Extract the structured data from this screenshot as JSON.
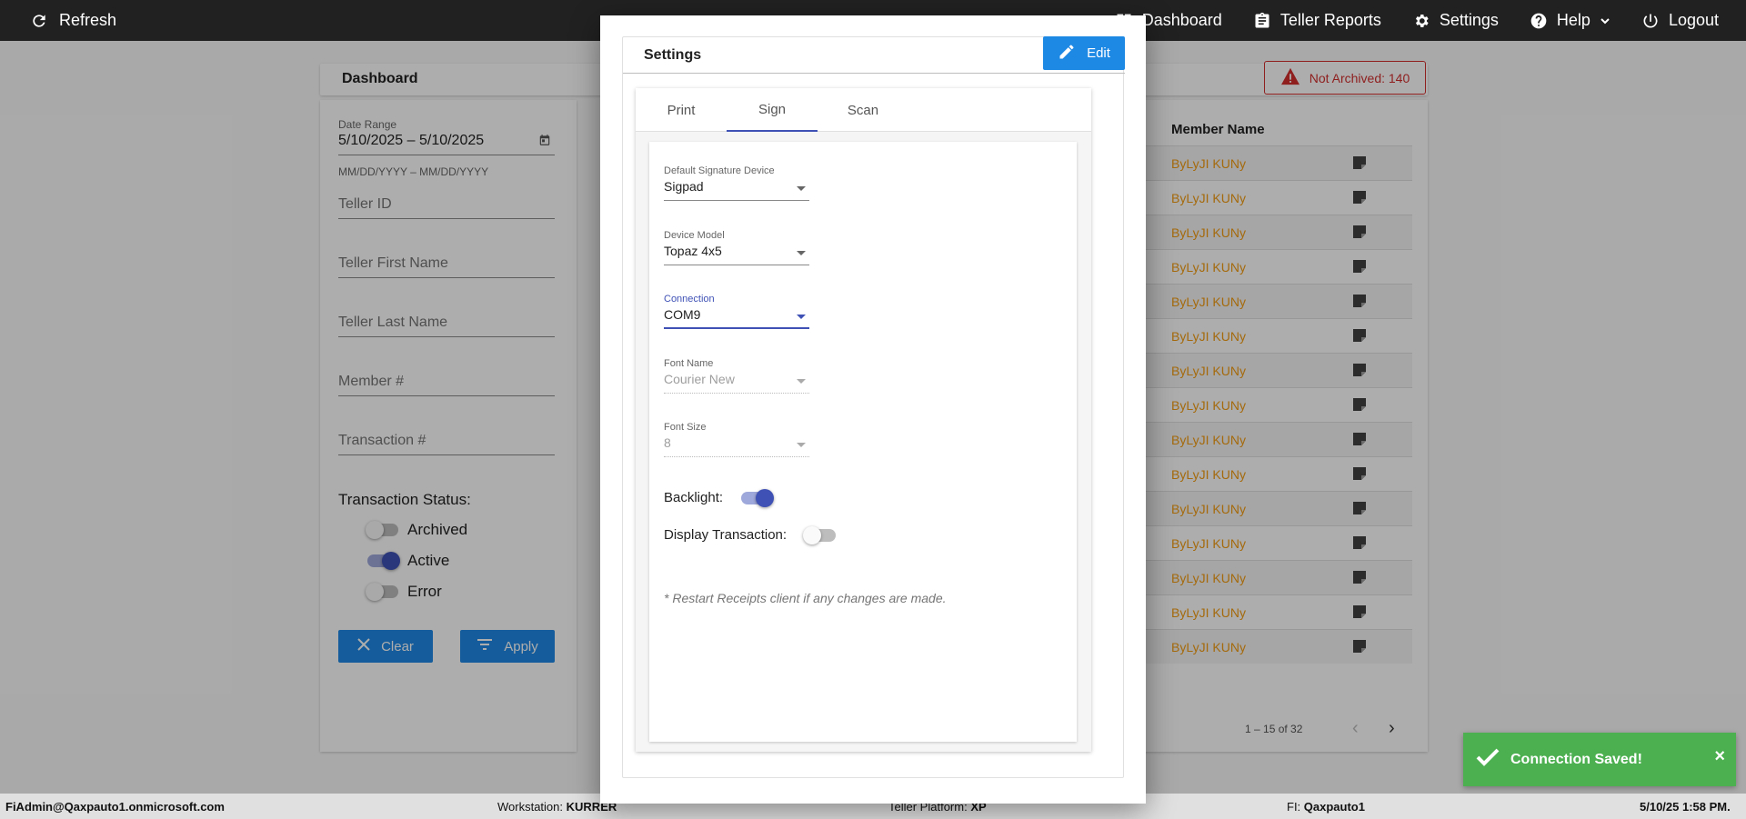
{
  "topbar": {
    "refresh_label": "Refresh",
    "nav": [
      {
        "label": "Dashboard",
        "icon": "dashboard-icon"
      },
      {
        "label": "Teller Reports",
        "icon": "clipboard-icon"
      },
      {
        "label": "Settings",
        "icon": "gear-icon"
      },
      {
        "label": "Help",
        "icon": "help-icon"
      },
      {
        "label": "Logout",
        "icon": "power-icon"
      }
    ]
  },
  "dashboard": {
    "title": "Dashboard",
    "not_archived": "Not Archived: 140",
    "filters": {
      "date_range_label": "Date Range",
      "date_range_value": "5/10/2025 – 5/10/2025",
      "date_hint": "MM/DD/YYYY – MM/DD/YYYY",
      "teller_id": "Teller ID",
      "teller_first_name": "Teller First Name",
      "teller_last_name": "Teller Last Name",
      "member_number": "Member #",
      "transaction_number": "Transaction #",
      "status_title": "Transaction Status:",
      "statuses": [
        {
          "label": "Archived",
          "on": false
        },
        {
          "label": "Active",
          "on": true
        },
        {
          "label": "Error",
          "on": false
        }
      ],
      "clear_label": "Clear",
      "apply_label": "Apply"
    },
    "table": {
      "member_name_header": "Member Name",
      "rows": [
        "ByLyJI KUNy",
        "ByLyJI KUNy",
        "ByLyJI KUNy",
        "ByLyJI KUNy",
        "ByLyJI KUNy",
        "ByLyJI KUNy",
        "ByLyJI KUNy",
        "ByLyJI KUNy",
        "ByLyJI KUNy",
        "ByLyJI KUNy",
        "ByLyJI KUNy",
        "ByLyJI KUNy",
        "ByLyJI KUNy",
        "ByLyJI KUNy",
        "ByLyJI KUNy"
      ],
      "pagination": "1 – 15 of 32"
    }
  },
  "modal": {
    "title": "Settings",
    "edit_label": "Edit",
    "tabs": [
      "Print",
      "Sign",
      "Scan"
    ],
    "active_tab": "Sign",
    "fields": {
      "default_device_label": "Default Signature Device",
      "default_device_value": "Sigpad",
      "device_model_label": "Device Model",
      "device_model_value": "Topaz 4x5",
      "connection_label": "Connection",
      "connection_value": "COM9",
      "font_name_label": "Font Name",
      "font_name_value": "Courier New",
      "font_size_label": "Font Size",
      "font_size_value": "8"
    },
    "backlight_label": "Backlight:",
    "backlight_on": true,
    "display_transaction_label": "Display Transaction:",
    "display_transaction_on": false,
    "note": "* Restart Receipts client if any changes are made."
  },
  "toast": {
    "message": "Connection Saved!",
    "close": "×"
  },
  "statusbar": {
    "user": "FiAdmin@Qaxpauto1.onmicrosoft.com",
    "workstation_label": "Workstation:",
    "workstation_value": "KURRER",
    "platform_label": "Teller Platform:",
    "platform_value": "XP",
    "fi_label": "FI:",
    "fi_value": "Qaxpauto1",
    "datetime": "5/10/25 1:58 PM."
  },
  "colors": {
    "topbar": "#212121",
    "primary_button": "#1e88e5",
    "accent": "#3f51b5",
    "alert": "#d32f2f",
    "success": "#4caf50",
    "member_name": "#f39c12"
  }
}
